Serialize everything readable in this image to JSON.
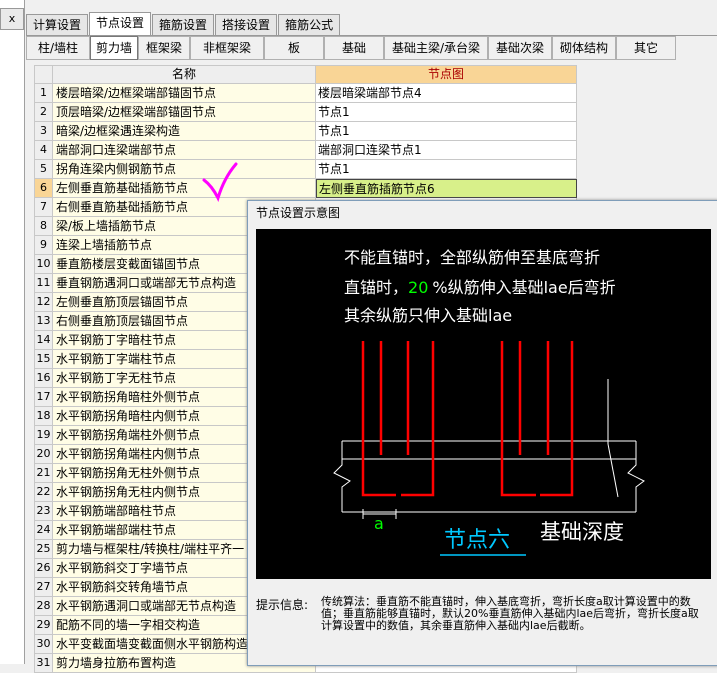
{
  "left_pane": {
    "mini_tab": "x"
  },
  "top_tabs": [
    "计算设置",
    "节点设置",
    "箍筋设置",
    "搭接设置",
    "箍筋公式"
  ],
  "sub_tabs": [
    "柱/墙柱",
    "剪力墙",
    "框架梁",
    "非框架梁",
    "板",
    "基础",
    "基础主梁/承台梁",
    "基础次梁",
    "砌体结构",
    "其它"
  ],
  "table": {
    "headers": {
      "name": "名称",
      "node": "节点图"
    },
    "rows": [
      {
        "idx": "1",
        "name": "楼层暗梁/边框梁端部锚固节点",
        "node": "楼层暗梁端部节点4"
      },
      {
        "idx": "2",
        "name": "顶层暗梁/边框梁端部锚固节点",
        "node": "节点1"
      },
      {
        "idx": "3",
        "name": "暗梁/边框梁遇连梁构造",
        "node": "节点1"
      },
      {
        "idx": "4",
        "name": "端部洞口连梁端部节点",
        "node": "端部洞口连梁节点1"
      },
      {
        "idx": "5",
        "name": "拐角连梁内侧钢筋节点",
        "node": "节点1"
      },
      {
        "idx": "6",
        "name": "左侧垂直筋基础插筋节点",
        "node": "左侧垂直筋插筋节点6"
      },
      {
        "idx": "7",
        "name": "右侧垂直筋基础插筋节点",
        "node": ""
      },
      {
        "idx": "8",
        "name": "梁/板上墙插筋节点",
        "node": ""
      },
      {
        "idx": "9",
        "name": "连梁上墙插筋节点",
        "node": ""
      },
      {
        "idx": "10",
        "name": "垂直筋楼层变截面锚固节点",
        "node": ""
      },
      {
        "idx": "11",
        "name": "垂直钢筋遇洞口或端部无节点构造",
        "node": ""
      },
      {
        "idx": "12",
        "name": "左侧垂直筋顶层锚固节点",
        "node": ""
      },
      {
        "idx": "13",
        "name": "右侧垂直筋顶层锚固节点",
        "node": ""
      },
      {
        "idx": "14",
        "name": "水平钢筋丁字暗柱节点",
        "node": ""
      },
      {
        "idx": "15",
        "name": "水平钢筋丁字端柱节点",
        "node": ""
      },
      {
        "idx": "16",
        "name": "水平钢筋丁字无柱节点",
        "node": ""
      },
      {
        "idx": "17",
        "name": "水平钢筋拐角暗柱外侧节点",
        "node": ""
      },
      {
        "idx": "18",
        "name": "水平钢筋拐角暗柱内侧节点",
        "node": ""
      },
      {
        "idx": "19",
        "name": "水平钢筋拐角端柱外侧节点",
        "node": ""
      },
      {
        "idx": "20",
        "name": "水平钢筋拐角端柱内侧节点",
        "node": ""
      },
      {
        "idx": "21",
        "name": "水平钢筋拐角无柱外侧节点",
        "node": ""
      },
      {
        "idx": "22",
        "name": "水平钢筋拐角无柱内侧节点",
        "node": ""
      },
      {
        "idx": "23",
        "name": "水平钢筋端部暗柱节点",
        "node": ""
      },
      {
        "idx": "24",
        "name": "水平钢筋端部端柱节点",
        "node": ""
      },
      {
        "idx": "25",
        "name": "剪力墙与框架柱/转换柱/端柱平齐一",
        "node": ""
      },
      {
        "idx": "26",
        "name": "水平钢筋斜交丁字墙节点",
        "node": ""
      },
      {
        "idx": "27",
        "name": "水平钢筋斜交转角墙节点",
        "node": ""
      },
      {
        "idx": "28",
        "name": "水平钢筋遇洞口或端部无节点构造",
        "node": ""
      },
      {
        "idx": "29",
        "name": "配筋不同的墙一字相交构造",
        "node": ""
      },
      {
        "idx": "30",
        "name": "水平变截面墙变截面侧水平钢筋构造",
        "node": ""
      },
      {
        "idx": "31",
        "name": "剪力墙身拉筋布置构造",
        "node": ""
      }
    ]
  },
  "popup": {
    "title": "节点设置示意图",
    "diagram": {
      "line1": "不能直锚时，全部纵筋伸至基底弯折",
      "line2_a": "直锚时，",
      "line2_pct": "20",
      "line2_b": "%纵筋伸入基础lae后弯折",
      "line3": "其余纵筋只伸入基础lae",
      "label_a": "a",
      "node_name": "节点六",
      "depth_label": "基础深度"
    },
    "hint_label": "提示信息:",
    "hint_text": "传统算法：垂直筋不能直锚时，伸入基底弯折，弯折长度a取计算设置中的数值；垂直筋能够直锚时，默认20%垂直筋伸入基础内lae后弯折，弯折长度a取计算设置中的数值，其余垂直筋伸入基础内lae后截断。"
  },
  "colors": {
    "accent_header": "#f9d596",
    "selected_cell": "#d8f08a",
    "rebar": "#ff0000",
    "check": "#ff00ff",
    "node_label": "#00c8ff",
    "pct": "#00ff00"
  }
}
